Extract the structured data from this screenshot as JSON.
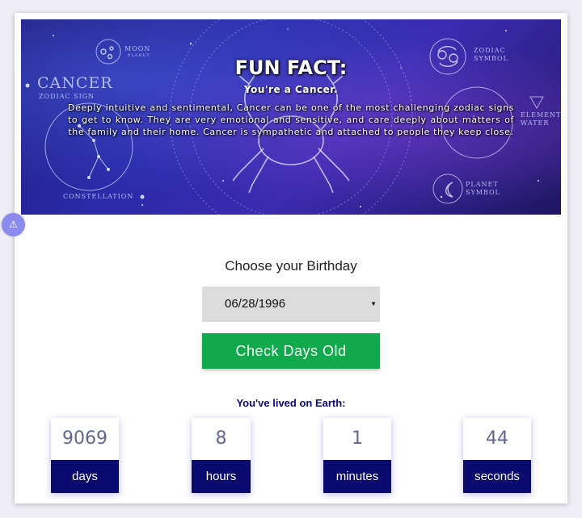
{
  "banner": {
    "title": "FUN FACT:",
    "subtitle": "You're a Cancer.",
    "body": "Deeply intuitive and sentimental, Cancer can be one of the most challenging zodiac signs to get to know. They are very emotional and sensitive, and care deeply about matters of the family and their home. Cancer is sympathetic and attached to people they keep close.",
    "art_labels": {
      "cancer": "CANCER",
      "zodiac_sign": "ZODIAC SIGN",
      "moon": "MOON",
      "planet": "PLANET",
      "zodiac_symbol": "ZODIAC SYMBOL",
      "element": "ELEMENT",
      "water": "WATER",
      "planet_symbol": "PLANET SYMBOL",
      "constellation": "CONSTELLATION"
    }
  },
  "alert_icon": "warning-icon",
  "birthday": {
    "label": "Choose your Birthday",
    "selected_value": "06/28/1996"
  },
  "check_button_label": "Check Days Old",
  "lived_label": "You've lived on Earth:",
  "counters": [
    {
      "value": "9069",
      "unit": "days"
    },
    {
      "value": "8",
      "unit": "hours"
    },
    {
      "value": "1",
      "unit": "minutes"
    },
    {
      "value": "44",
      "unit": "seconds"
    }
  ],
  "colors": {
    "accent_button": "#10a94b",
    "counter_unit_bg": "#0a0a6e",
    "lived_text": "#0a0a78"
  }
}
